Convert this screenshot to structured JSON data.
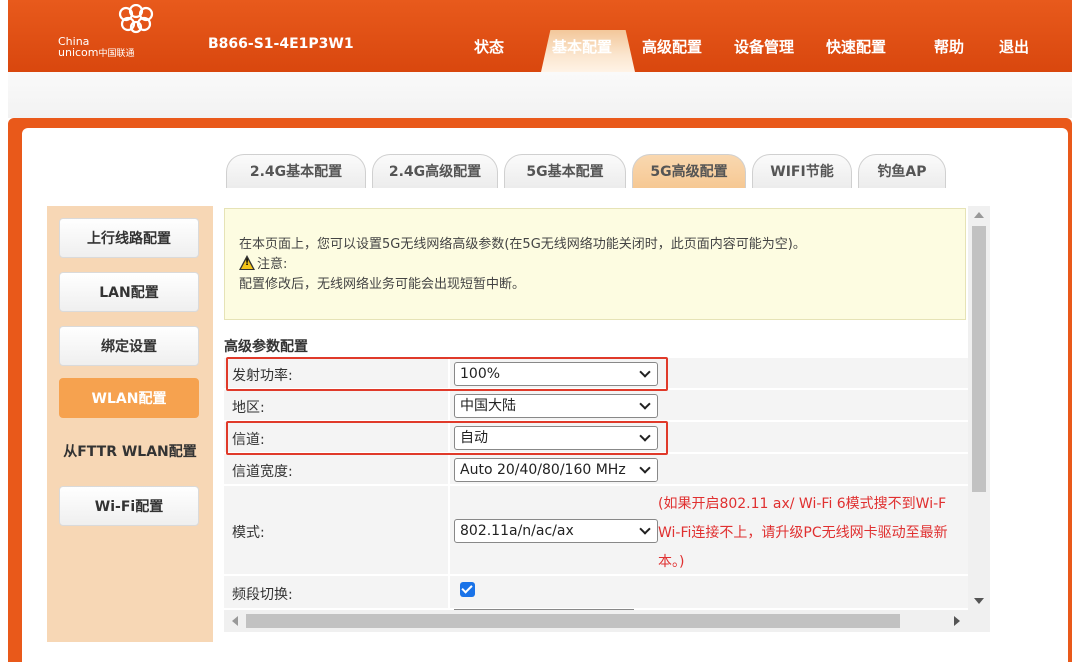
{
  "brand": {
    "logo_en_line1": "China",
    "logo_en_line2": "unicom",
    "logo_cn": "中国联通",
    "device_id": "B866-S1-4E1P3W1"
  },
  "topnav": {
    "items": [
      "状态",
      "基本配置",
      "高级配置",
      "设备管理",
      "快速配置",
      "帮助",
      "退出"
    ],
    "active": "基本配置"
  },
  "tabs": {
    "items": [
      "2.4G基本配置",
      "2.4G高级配置",
      "5G基本配置",
      "5G高级配置",
      "WIFI节能",
      "钓鱼AP"
    ],
    "active": "5G高级配置"
  },
  "sidebar": {
    "items": [
      "上行线路配置",
      "LAN配置",
      "绑定设置",
      "WLAN配置",
      "从FTTR WLAN配置",
      "Wi-Fi配置"
    ],
    "active": "WLAN配置"
  },
  "info": {
    "line1": "在本页面上，您可以设置5G无线网络高级参数(在5G无线网络功能关闭时，此页面内容可能为空)。",
    "notice_label": "注意:",
    "line3": "配置修改后，无线网络业务可能会出现短暂中断。"
  },
  "section_title": "高级参数配置",
  "form": {
    "tx_power": {
      "label": "发射功率:",
      "value": "100%"
    },
    "region": {
      "label": "地区:",
      "value": "中国大陆"
    },
    "channel": {
      "label": "信道:",
      "value": "自动"
    },
    "bandwidth": {
      "label": "信道宽度:",
      "value": "Auto 20/40/80/160 MHz"
    },
    "mode": {
      "label": "模式:",
      "value": "802.11a/n/ac/ax"
    },
    "band_steering": {
      "label": "频段切换:",
      "checked": true
    }
  },
  "mode_note": {
    "line1": "(如果开启802.11 ax/ Wi-Fi 6模式搜不到Wi-F",
    "line2": "Wi-Fi连接不上，请升级PC无线网卡驱动至最新",
    "line3": "本。)"
  },
  "colors": {
    "brand_orange": "#e85a1c",
    "sidebar_bg": "#f7d7b5",
    "active_orange": "#f6a24f",
    "highlight_red": "#e03a2a",
    "note_red": "#e03030"
  }
}
